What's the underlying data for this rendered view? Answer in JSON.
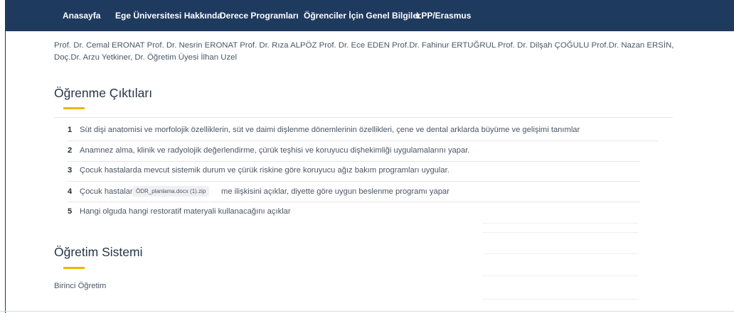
{
  "nav": {
    "items": [
      {
        "label": "Anasayfa"
      },
      {
        "label": "Ege Üniversitesi Hakkında"
      },
      {
        "label": "Derece Programları"
      },
      {
        "label": "Öğrenciler İçin Genel Bilgiler"
      },
      {
        "label": "LPP/Erasmus"
      }
    ]
  },
  "faculty": {
    "text": "Prof. Dr. Cemal ERONAT Prof. Dr. Nesrin ERONAT Prof. Dr. Rıza ALPÖZ Prof. Dr. Ece EDEN Prof.Dr. Fahinur ERTUĞRUL Prof. Dr. Dilşah ÇOĞULU Prof.Dr. Nazan ERSİN, Doç.Dr. Arzu Yetkiner, Dr. Öğretim Üyesi İlhan Uzel"
  },
  "outcomes": {
    "title": "Öğrenme Çıktıları",
    "items": [
      {
        "num": "1",
        "text": "Süt dişi anatomisi ve morfolojik özelliklerin, süt ve daimi dişlenme dönemlerinin özellikleri, çene ve dental arklarda büyüme ve gelişimi tanımlar"
      },
      {
        "num": "2",
        "text": "Anamnez alma, klinik ve radyolojik değerlendirme, çürük teşhisi ve koruyucu dişhekimliği uygulamalarını yapar."
      },
      {
        "num": "3",
        "text": "Çocuk hastalarda mevcut sistemik durum ve çürük riskine göre koruyucu ağız bakım programları uygular."
      },
      {
        "num": "4",
        "text_before": "Çocuk hastaları",
        "text_after": "me ilişkisini açıklar, diyette göre uygun beslenme programı yapar"
      },
      {
        "num": "5",
        "text": "Hangi olguda hangi restoratif materyali kullanacağını açıklar"
      }
    ]
  },
  "download_chip": {
    "label": "ÖDR_planlama.docx (1).zip"
  },
  "system": {
    "title": "Öğretim Sistemi",
    "value": "Birinci Öğretim"
  }
}
